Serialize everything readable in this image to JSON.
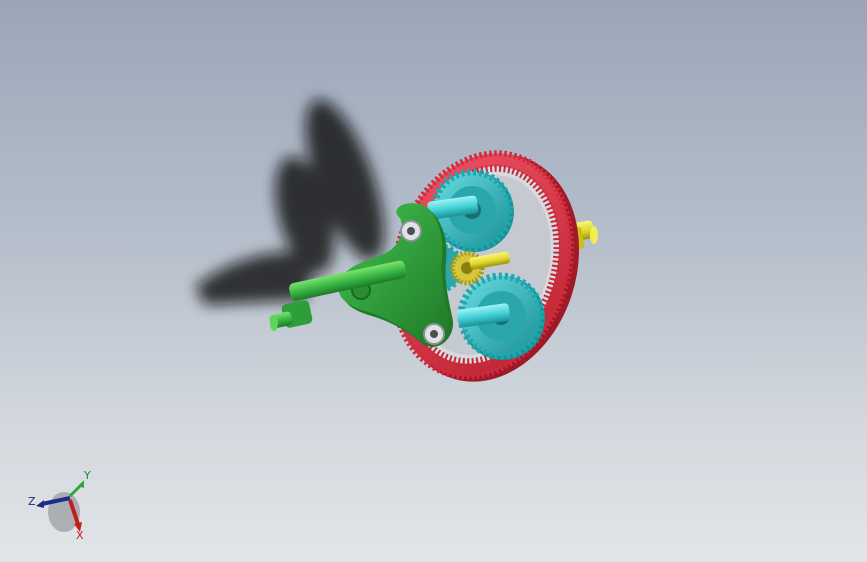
{
  "viewport": {
    "triad": {
      "x_label": "X",
      "y_label": "Y",
      "z_label": "Z"
    },
    "colors": {
      "ring_gear": "#e0354a",
      "planet_gears": "#35c2c8",
      "sun_gear": "#d6c63a",
      "output_shaft": "#e6e22a",
      "carrier": "#2f9e3a",
      "input_shaft": "#39c04a",
      "background_top": "#9aa6b8",
      "background_bottom": "#e2e5e8"
    },
    "icons": [
      "reference-triad-icon"
    ]
  }
}
